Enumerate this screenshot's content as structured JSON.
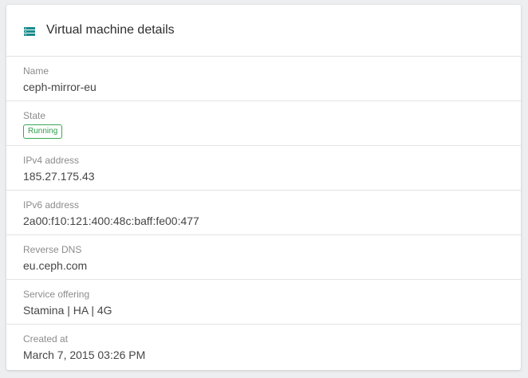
{
  "card": {
    "icon": "server-list-icon",
    "title": "Virtual machine details"
  },
  "details": {
    "name": {
      "label": "Name",
      "value": "ceph-mirror-eu"
    },
    "state": {
      "label": "State",
      "value": "Running",
      "badge_color": "#2f9e4d"
    },
    "ipv4": {
      "label": "IPv4 address",
      "value": "185.27.175.43"
    },
    "ipv6": {
      "label": "IPv6 address",
      "value": "2a00:f10:121:400:48c:baff:fe00:477"
    },
    "reverse_dns": {
      "label": "Reverse DNS",
      "value": "eu.ceph.com"
    },
    "service_offering": {
      "label": "Service offering",
      "value": "Stamina | HA | 4G"
    },
    "created_at": {
      "label": "Created at",
      "value": "March 7, 2015 03:26 PM"
    }
  },
  "colors": {
    "accent": "#1a8a8a",
    "status_running": "#3aa757"
  }
}
